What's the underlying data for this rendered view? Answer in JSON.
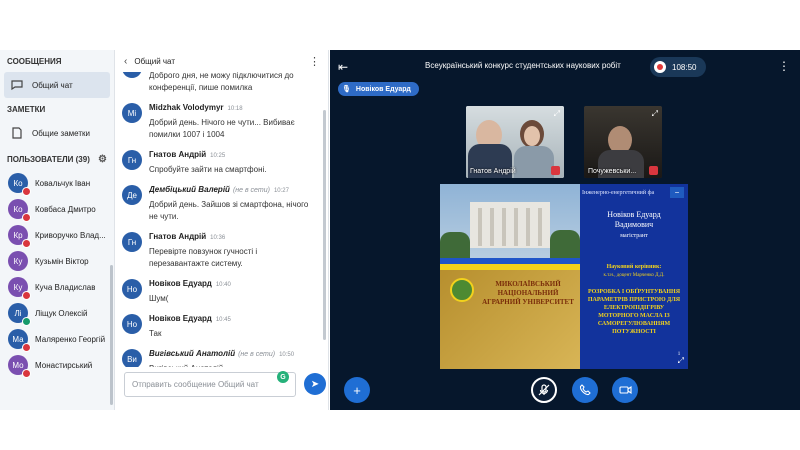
{
  "sidebar": {
    "messages_heading": "СООБЩЕНИЯ",
    "public_chat": "Общий чат",
    "notes_heading": "ЗАМЕТКИ",
    "shared_notes": "Общие заметки",
    "users_heading": "ПОЛЬЗОВАТЕЛИ (39)",
    "users": [
      {
        "initials": "Ко",
        "name": "Ковальчук Іван",
        "color": "#2a5ea8",
        "mic": "muted"
      },
      {
        "initials": "Ко",
        "name": "Ковбаса Дмитро",
        "color": "#7a4fb0",
        "mic": "muted"
      },
      {
        "initials": "Кр",
        "name": "Криворучко Влад...",
        "color": "#7a4fb0",
        "mic": "muted"
      },
      {
        "initials": "Ку",
        "name": "Кузьмін Віктор",
        "color": "#7a4fb0",
        "mic": ""
      },
      {
        "initials": "Ку",
        "name": "Куча Владислав",
        "color": "#7a4fb0",
        "mic": "muted"
      },
      {
        "initials": "Лі",
        "name": "Ліщук Олексій",
        "color": "#2a5ea8",
        "mic": "on"
      },
      {
        "initials": "Ма",
        "name": "Маляренко Георгій",
        "color": "#2a5ea8",
        "mic": "muted"
      },
      {
        "initials": "Мо",
        "name": "Монастирський",
        "color": "#7a4fb0",
        "mic": "muted"
      }
    ]
  },
  "chat": {
    "title": "Общий чат",
    "composer_placeholder": "Отправить сообщение Общий чат",
    "messages": [
      {
        "initials": "Ви",
        "author": "",
        "status": "",
        "time": "",
        "text": "Доброго дня, не можу підключитися до конференції, пише помилка"
      },
      {
        "initials": "Mi",
        "author": "Midzhak Volodymyr",
        "status": "",
        "time": "10:18",
        "text": "Добрий день. Нічого не чути... Вибиває помилки 1007 і 1004"
      },
      {
        "initials": "Гн",
        "author": "Гнатов Андрій",
        "status": "",
        "time": "10:25",
        "text": "Спробуйте зайти на смартфоні."
      },
      {
        "initials": "Де",
        "author": "Дембіцький Валерій",
        "status": "(не в сети)",
        "time": "10:27",
        "text": "Добрий день. Зайшов зі смартфона, нічого не чути."
      },
      {
        "initials": "Гн",
        "author": "Гнатов Андрій",
        "status": "",
        "time": "10:36",
        "text": "Перевірте повзунок гучності і перезавантажте систему."
      },
      {
        "initials": "Но",
        "author": "Новіков Едуард",
        "status": "",
        "time": "10:40",
        "text": "Шум("
      },
      {
        "initials": "Но",
        "author": "Новіков Едуард",
        "status": "",
        "time": "10:45",
        "text": "Так"
      },
      {
        "initials": "Ви",
        "author": "Вигівський Анатолій",
        "status": "(не в сети)",
        "time": "10:50",
        "text": "Вигівський Анатолій"
      }
    ]
  },
  "meeting": {
    "title": "Всеукраїнський конкурс студентських наукових робіт",
    "timer": "108:50",
    "talking": "Новіков Едуард",
    "tiles": [
      {
        "name": "Гнатов Андрій"
      },
      {
        "name": "Почужевськи..."
      }
    ]
  },
  "slide": {
    "faculty": "Інженерно-енергетичний фа",
    "student": "Новіков Едуард Вадимович",
    "role": "магістрант",
    "advisor_label": "Науковий керівник:",
    "advisor": "к.т.н., доцент Марченко Д.Д.",
    "topic": "РОЗРОБКА І ОБҐРУНТУВАННЯ ПАРАМЕТРІВ ПРИСТРОЮ ДЛЯ ЕЛЕКТРОПІДІГРІВУ МОТОРНОГО МАСЛА ІЗ САМОРЕГУЛЮВАННЯМ ПОТУЖНОСТІ",
    "university": "МИКОЛАЇВСЬКИЙ НАЦІОНАЛЬНИЙ АГРАРНИЙ УНІВЕРСИТЕТ",
    "page": "1"
  }
}
